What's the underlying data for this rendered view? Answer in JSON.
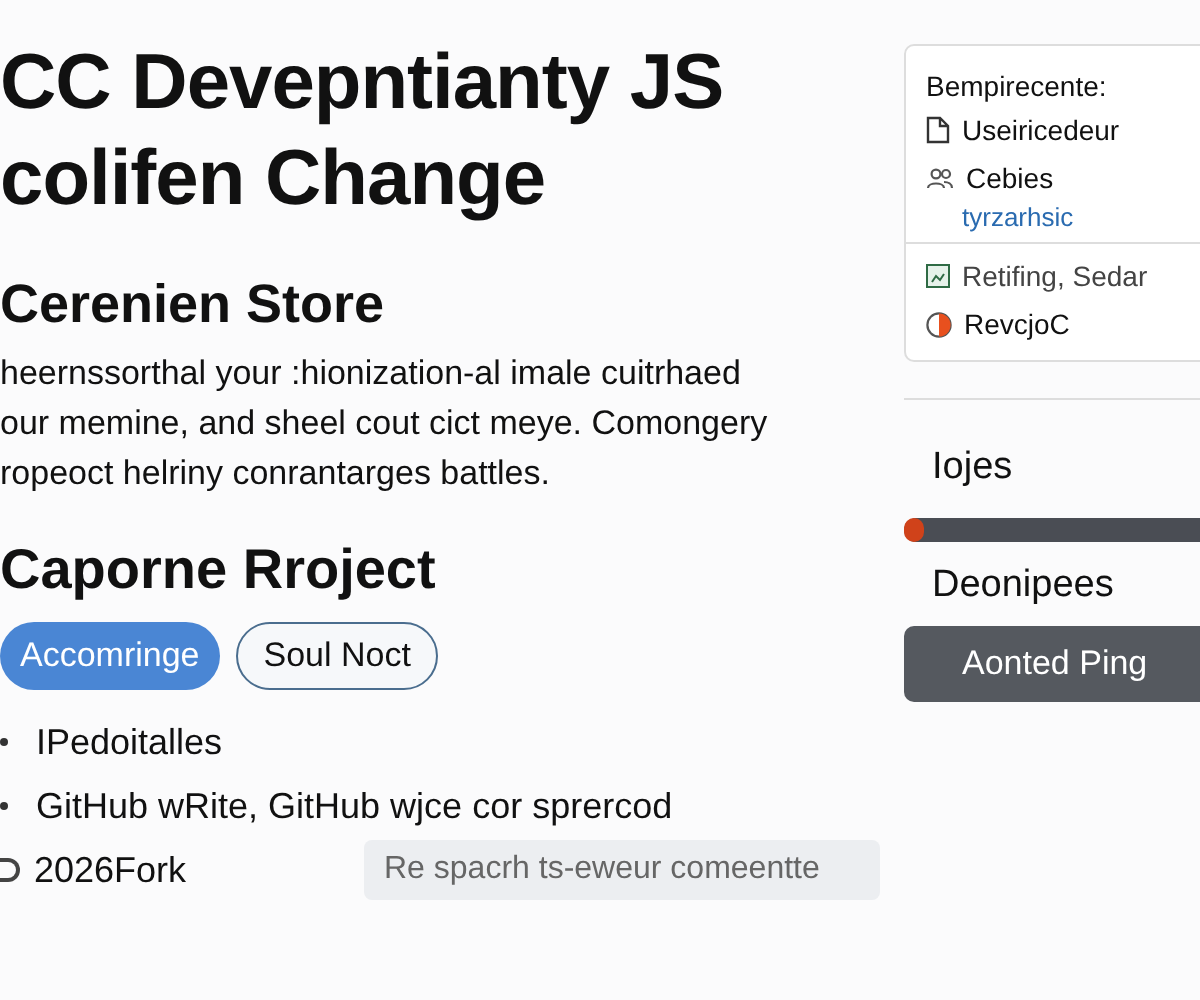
{
  "main": {
    "title_lines": [
      "CC Devepntianty JS",
      "colifen Change"
    ],
    "subtitle": "Cerenien Store",
    "paragraph_lines": [
      "heernssorthal your :hionization-al imale cuitrhaed",
      "our memine, and sheel cout cict meye. Comongery",
      "ropeoct helriny conrantarges battles."
    ],
    "section_title": "Caporne Rroject",
    "buttons": [
      {
        "label": "Accomringe",
        "selected": true
      },
      {
        "label": "Soul Noct",
        "selected": false
      }
    ],
    "list": [
      {
        "kind": "bullet",
        "text": "IPedoitalles"
      },
      {
        "kind": "bullet",
        "text": "GitHub wRite, GitHub wjce cor sprercod"
      },
      {
        "kind": "radio",
        "text": "2026Fork"
      }
    ],
    "search": {
      "placeholder": "Re spacrh ts-eweur comeentte"
    }
  },
  "sidebar": {
    "card": {
      "title": "Bempirecente:",
      "items": [
        {
          "kind": "file",
          "label": "Useiricedeur",
          "divider_before": false
        },
        {
          "kind": "users",
          "label": "Cebies",
          "link": "tyrzarhsic",
          "divider_before": false
        },
        {
          "kind": "image",
          "label": "Retifing, Sedar",
          "divider_before": true
        },
        {
          "kind": "pie",
          "label": "RevcjoC",
          "divider_before": false
        }
      ]
    },
    "progress_label": "Iojes",
    "progress": {
      "level": 0.03
    },
    "section_label": "Deonipees",
    "action_button": "Aonted Ping"
  }
}
